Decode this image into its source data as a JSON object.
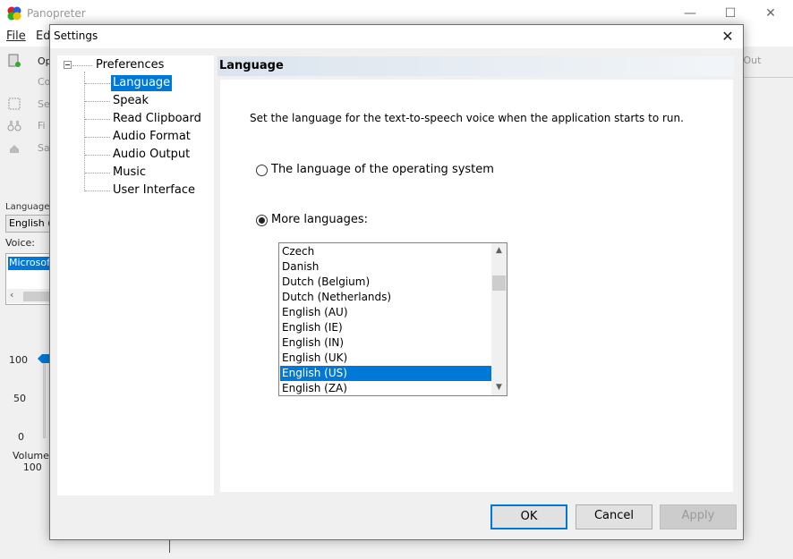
{
  "app": {
    "title": "Panopreter",
    "window_controls": {
      "minimize": "—",
      "maximize": "☐",
      "close": "✕"
    }
  },
  "menu": {
    "file": "File",
    "edit": "Ed"
  },
  "toolbar": {
    "items": [
      "Op",
      "Co",
      "Sele",
      "Fi",
      "Sa"
    ]
  },
  "left_panel": {
    "language_label": "Language:",
    "language_value": "English (U",
    "voice_label": "Voice:",
    "voice_selected": "Microsoft",
    "volume_ticks": [
      "100",
      "50",
      "0"
    ],
    "volume_label": "Volume:",
    "volume_value": "100",
    "volume_level_percent": 100
  },
  "right_panel": {
    "fade_out": "n Out"
  },
  "dialog": {
    "title": "Settings",
    "close": "✕",
    "tree": {
      "root": "Preferences",
      "children": [
        "Language",
        "Speak",
        "Read Clipboard",
        "Audio Format",
        "Audio Output",
        "Music",
        "User Interface"
      ],
      "selected": "Language"
    },
    "section_title": "Language",
    "description": "Set the language for the text-to-speech voice when the application starts to run.",
    "radio_os": "The language of the operating system",
    "radio_more": "More languages:",
    "radio_more_checked": true,
    "languages": [
      "Czech",
      "Danish",
      "Dutch (Belgium)",
      "Dutch (Netherlands)",
      "English (AU)",
      "English (IE)",
      "English (IN)",
      "English (UK)",
      "English (US)",
      "English (ZA)"
    ],
    "selected_language": "English (US)",
    "buttons": {
      "ok": "OK",
      "cancel": "Cancel",
      "apply": "Apply"
    }
  },
  "colors": {
    "accent": "#0078d7",
    "header_gradient_start": "#dbe4ee"
  }
}
